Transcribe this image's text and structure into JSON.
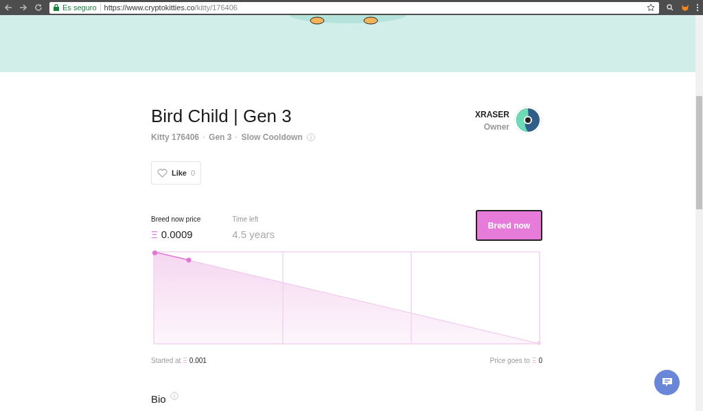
{
  "browser": {
    "security": "Es seguro",
    "url_host": "https://www.cryptokitties.co",
    "url_path": "/kitty/176406"
  },
  "kitty": {
    "title": "Bird Child | Gen 3",
    "meta": [
      "Kitty 176406",
      "Gen 3",
      "Slow Cooldown"
    ]
  },
  "owner": {
    "name": "XRASER",
    "role": "Owner"
  },
  "like": {
    "label": "Like",
    "count": "0"
  },
  "breed": {
    "price_label": "Breed now price",
    "currency": "Ξ",
    "price": "0.0009",
    "time_label": "Time left",
    "time": "4.5 years",
    "button": "Breed now"
  },
  "price_range": {
    "start_label": "Started at",
    "start_currency": "Ξ",
    "start": "0.001",
    "end_label": "Price goes to",
    "end_currency": "Ξ",
    "end": "0"
  },
  "bio": {
    "heading": "Bio"
  }
}
